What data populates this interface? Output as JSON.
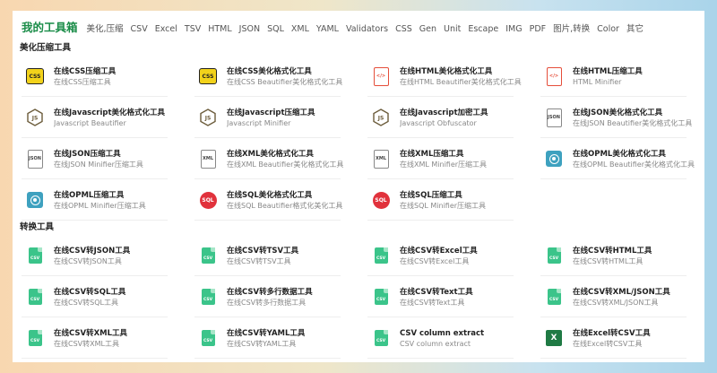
{
  "nav": {
    "brand": "我的工具箱",
    "links": [
      "美化,压缩",
      "CSV",
      "Excel",
      "TSV",
      "HTML",
      "JSON",
      "SQL",
      "XML",
      "YAML",
      "Validators",
      "CSS",
      "Gen",
      "Unit",
      "Escape",
      "IMG",
      "PDF",
      "图片,转换",
      "Color",
      "其它"
    ]
  },
  "sections": [
    {
      "title": "美化压缩工具",
      "items": [
        {
          "title": "在线CSS压缩工具",
          "sub": "在线CSS压缩工具",
          "icon": "css-badge-icon",
          "glyph": "CSS"
        },
        {
          "title": "在线CSS美化格式化工具",
          "sub": "在线CSS Beautifier美化格式化工具",
          "icon": "css-badge-icon",
          "glyph": "CSS"
        },
        {
          "title": "在线HTML美化格式化工具",
          "sub": "在线HTML Beautifier美化格式化工具",
          "icon": "html-file-icon",
          "glyph": "</>"
        },
        {
          "title": "在线HTML压缩工具",
          "sub": "HTML Minifier",
          "icon": "html-file-icon",
          "glyph": "</>"
        },
        {
          "title": "在线Javascript美化格式化工具",
          "sub": "Javascript Beautifier",
          "icon": "js-hexagon-icon",
          "glyph": "JS"
        },
        {
          "title": "在线Javascript压缩工具",
          "sub": "Javascript Minifier",
          "icon": "js-hexagon-icon",
          "glyph": "JS"
        },
        {
          "title": "在线Javascript加密工具",
          "sub": "Javascript Obfuscator",
          "icon": "js-hexagon-icon",
          "glyph": "JS"
        },
        {
          "title": "在线JSON美化格式化工具",
          "sub": "在线JSON Beautifier美化格式化工具",
          "icon": "json-file-icon",
          "glyph": "JSON"
        },
        {
          "title": "在线JSON压缩工具",
          "sub": "在线JSON Minifier压缩工具",
          "icon": "json-file-icon",
          "glyph": "JSON"
        },
        {
          "title": "在线XML美化格式化工具",
          "sub": "在线XML Beautifier美化格式化工具",
          "icon": "xml-file-icon",
          "glyph": "XML"
        },
        {
          "title": "在线XML压缩工具",
          "sub": "在线XML Minifier压缩工具",
          "icon": "xml-file-icon",
          "glyph": "XML"
        },
        {
          "title": "在线OPML美化格式化工具",
          "sub": "在线OPML Beautifier美化格式化工具",
          "icon": "opml-icon",
          "glyph": ""
        },
        {
          "title": "在线OPML压缩工具",
          "sub": "在线OPML Minifier压缩工具",
          "icon": "opml-icon",
          "glyph": ""
        },
        {
          "title": "在线SQL美化格式化工具",
          "sub": "在线SQL Beautifier格式化美化工具",
          "icon": "sql-icon",
          "glyph": "SQL"
        },
        {
          "title": "在线SQL压缩工具",
          "sub": "在线SQL Minifier压缩工具",
          "icon": "sql-icon",
          "glyph": "SQL"
        }
      ]
    },
    {
      "title": "转换工具",
      "items": [
        {
          "title": "在线CSV转JSON工具",
          "sub": "在线CSV转JSON工具",
          "icon": "csv-file-icon",
          "glyph": "CSV"
        },
        {
          "title": "在线CSV转TSV工具",
          "sub": "在线CSV转TSV工具",
          "icon": "csv-file-icon",
          "glyph": "CSV"
        },
        {
          "title": "在线CSV转Excel工具",
          "sub": "在线CSV转Excel工具",
          "icon": "csv-file-icon",
          "glyph": "CSV"
        },
        {
          "title": "在线CSV转HTML工具",
          "sub": "在线CSV转HTML工具",
          "icon": "csv-file-icon",
          "glyph": "CSV"
        },
        {
          "title": "在线CSV转SQL工具",
          "sub": "在线CSV转SQL工具",
          "icon": "csv-file-icon",
          "glyph": "CSV"
        },
        {
          "title": "在线CSV转多行数据工具",
          "sub": "在线CSV转多行数据工具",
          "icon": "csv-file-icon",
          "glyph": "CSV"
        },
        {
          "title": "在线CSV转Text工具",
          "sub": "在线CSV转Text工具",
          "icon": "csv-file-icon",
          "glyph": "CSV"
        },
        {
          "title": "在线CSV转XML/JSON工具",
          "sub": "在线CSV转XML/JSON工具",
          "icon": "csv-file-icon",
          "glyph": "CSV"
        },
        {
          "title": "在线CSV转XML工具",
          "sub": "在线CSV转XML工具",
          "icon": "csv-file-icon",
          "glyph": "CSV"
        },
        {
          "title": "在线CSV转YAML工具",
          "sub": "在线CSV转YAML工具",
          "icon": "csv-file-icon",
          "glyph": "CSV"
        },
        {
          "title": "CSV column extract",
          "sub": "CSV column extract",
          "icon": "csv-file-icon",
          "glyph": "CSV"
        },
        {
          "title": "在线Excel转CSV工具",
          "sub": "在线Excel转CSV工具",
          "icon": "excel-icon",
          "glyph": "X"
        }
      ]
    }
  ]
}
